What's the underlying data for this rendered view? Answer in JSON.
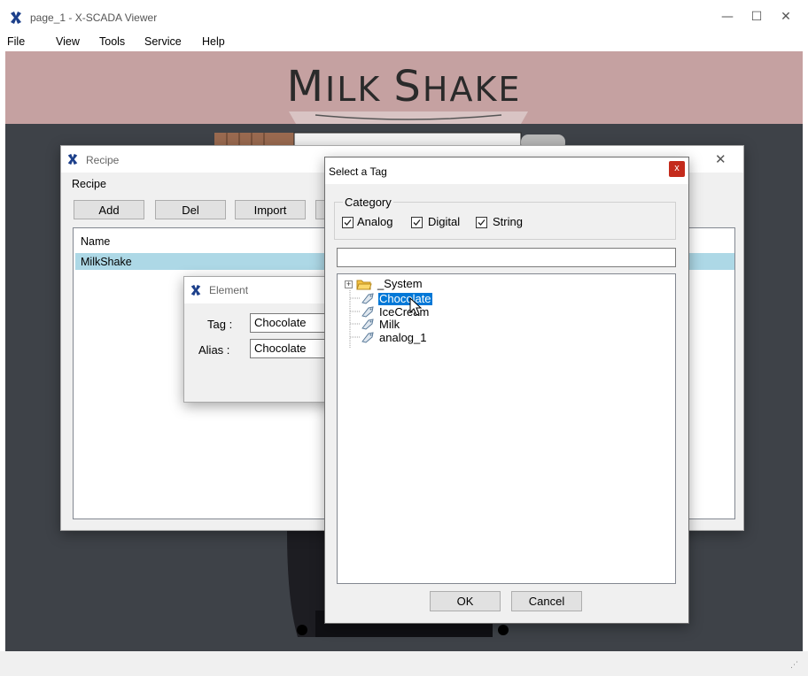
{
  "window": {
    "title": "page_1 - X-SCADA Viewer",
    "controls": {
      "minimize": "—",
      "maximize": "☐",
      "close": "✕"
    }
  },
  "menu": [
    "File",
    "View",
    "Tools",
    "Service",
    "Help"
  ],
  "banner": {
    "title_lead": "M",
    "title_rest": "ILK ",
    "title_lead2": "S",
    "title_rest2": "HAKE"
  },
  "recipe_window": {
    "title": "Recipe",
    "group_label": "Recipe",
    "buttons": {
      "add": "Add",
      "del": "Del",
      "import": "Import"
    },
    "list_header": "Name",
    "rows": [
      "MilkShake"
    ],
    "close": "✕"
  },
  "element_window": {
    "title": "Element",
    "tag_label": "Tag :",
    "tag_value": "Chocolate",
    "alias_label": "Alias :",
    "alias_value": "Chocolate"
  },
  "select_tag_dialog": {
    "title": "Select a Tag",
    "close": "x",
    "category_label": "Category",
    "checkboxes": [
      {
        "label": "Analog",
        "checked": true
      },
      {
        "label": "Digital",
        "checked": true
      },
      {
        "label": "String",
        "checked": true
      }
    ],
    "search_value": "",
    "tree": {
      "folder": "_System",
      "tags": [
        "Chocolate",
        "IceCream",
        "Milk",
        "analog_1"
      ],
      "selected": "Chocolate"
    },
    "ok": "OK",
    "cancel": "Cancel"
  },
  "colors": {
    "banner": "#c5a1a1",
    "scene": "#3e4248",
    "selection": "#0078d7",
    "row_highlight": "#add8e6",
    "dialog_close": "#c42b1c"
  }
}
